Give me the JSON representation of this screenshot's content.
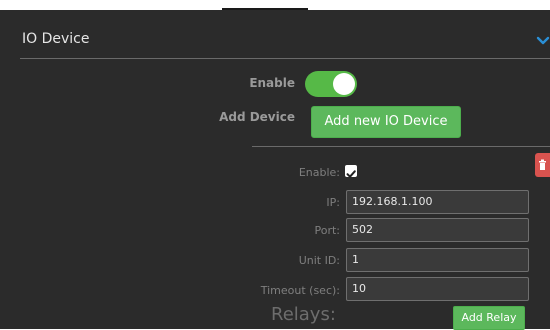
{
  "panel": {
    "title": "IO Device"
  },
  "form": {
    "enable_label": "Enable",
    "enable_on": true,
    "add_device_label": "Add Device",
    "add_device_button": "Add new IO Device"
  },
  "device": {
    "enable_label": "Enable:",
    "enable_checked": true,
    "ip_label": "IP:",
    "ip_value": "192.168.1.100",
    "port_label": "Port:",
    "port_value": "502",
    "unit_id_label": "Unit ID:",
    "unit_id_value": "1",
    "timeout_label": "Timeout (sec):",
    "timeout_value": "10",
    "relays_label": "Relays:",
    "add_relay_button": "Add Relay"
  },
  "icons": {
    "chevron": "chevron-down-icon",
    "trash": "trash-icon",
    "check": "checkmark-icon"
  },
  "colors": {
    "background": "#2b2b2b",
    "accent_green": "#5cb85c",
    "toggle_green": "#56b947",
    "danger_red": "#d9534f",
    "chevron_blue": "#2a8fd6"
  }
}
